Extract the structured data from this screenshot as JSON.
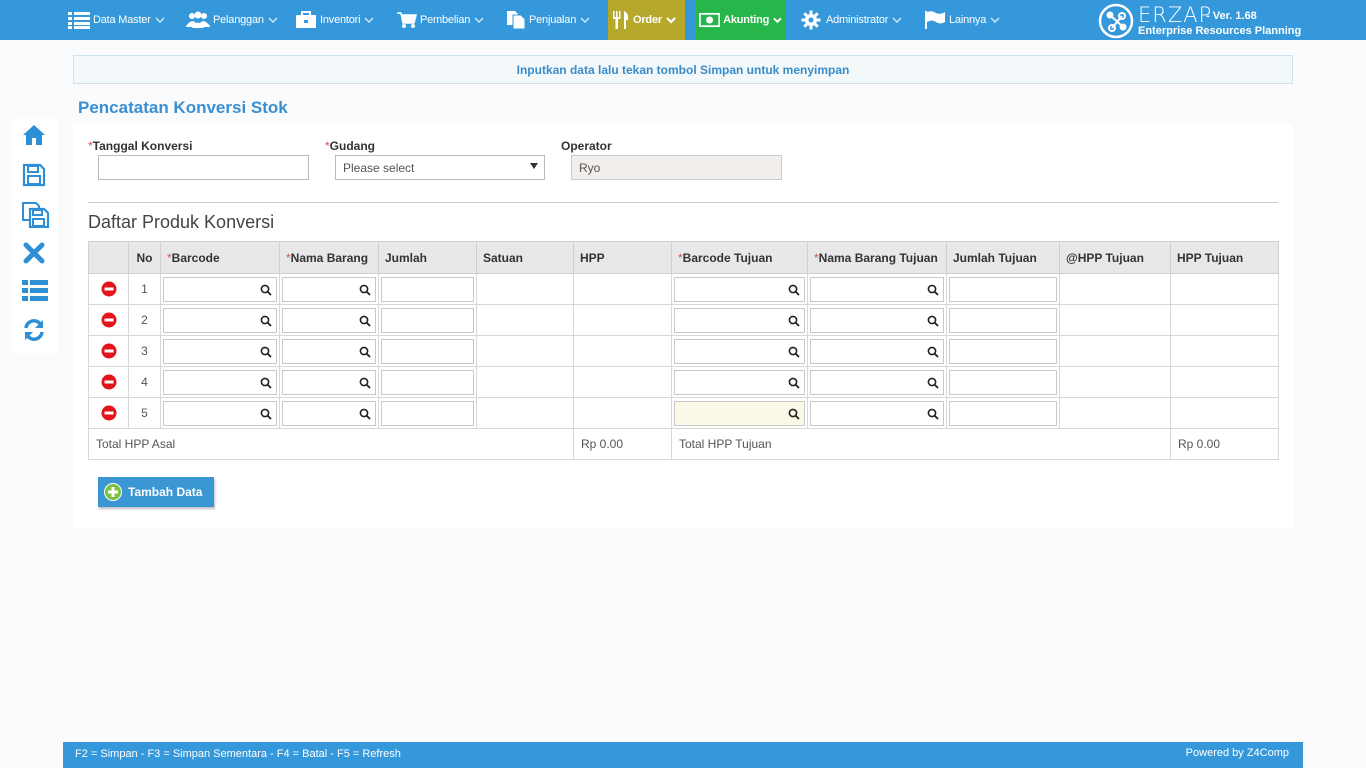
{
  "nav": {
    "items": [
      {
        "label": "Data Master",
        "icon": "list-icon"
      },
      {
        "label": "Pelanggan",
        "icon": "users-icon"
      },
      {
        "label": "Inventori",
        "icon": "briefcase-icon"
      },
      {
        "label": "Pembelian",
        "icon": "cart-icon"
      },
      {
        "label": "Penjualan",
        "icon": "documents-icon"
      },
      {
        "label": "Order",
        "icon": "cutlery-icon",
        "active_color": "#b5a82b"
      },
      {
        "label": "Akunting",
        "icon": "money-icon",
        "active_color": "#27b64a"
      },
      {
        "label": "Administrator",
        "icon": "gear-icon"
      },
      {
        "label": "Lainnya",
        "icon": "flag-icon"
      }
    ]
  },
  "brand": {
    "name": "ERZAP",
    "version": "- Ver. 1.68",
    "subtitle": "Enterprise Resources Planning"
  },
  "info_message": "Inputkan data lalu tekan tombol Simpan untuk menyimpan",
  "page_title": "Pencatatan Konversi Stok",
  "form": {
    "tanggal": {
      "label": "Tanggal Konversi",
      "required_mark": "*",
      "value": ""
    },
    "gudang": {
      "label": "Gudang",
      "required_mark": "*",
      "value": "Please select"
    },
    "operator": {
      "label": "Operator",
      "value": "Ryo"
    }
  },
  "section_title": "Daftar Produk Konversi",
  "table": {
    "headers": [
      {
        "label": "",
        "required": false
      },
      {
        "label": "No",
        "required": false
      },
      {
        "label": "Barcode",
        "required": true
      },
      {
        "label": "Nama Barang",
        "required": true
      },
      {
        "label": "Jumlah",
        "required": false
      },
      {
        "label": "Satuan",
        "required": false
      },
      {
        "label": "HPP",
        "required": false
      },
      {
        "label": "Barcode Tujuan",
        "required": true
      },
      {
        "label": "Nama Barang Tujuan",
        "required": true
      },
      {
        "label": "Jumlah Tujuan",
        "required": false
      },
      {
        "label": "@HPP Tujuan",
        "required": false
      },
      {
        "label": "HPP Tujuan",
        "required": false
      }
    ],
    "rows": [
      {
        "no": "1"
      },
      {
        "no": "2"
      },
      {
        "no": "3"
      },
      {
        "no": "4"
      },
      {
        "no": "5"
      }
    ],
    "total_asal_label": "Total HPP Asal",
    "total_asal_value": "Rp 0.00",
    "total_tujuan_label": "Total HPP Tujuan",
    "total_tujuan_value": "Rp 0.00"
  },
  "add_button_label": "Tambah Data",
  "footer": {
    "shortcuts": "F2 = Simpan - F3 = Simpan Sementara - F4 = Batal - F5 = Refresh",
    "powered": "Powered by Z4Comp"
  },
  "colors": {
    "primary": "#3498db",
    "title": "#3a8fd1",
    "required": "#d9534f",
    "delete": "#e3151a"
  }
}
